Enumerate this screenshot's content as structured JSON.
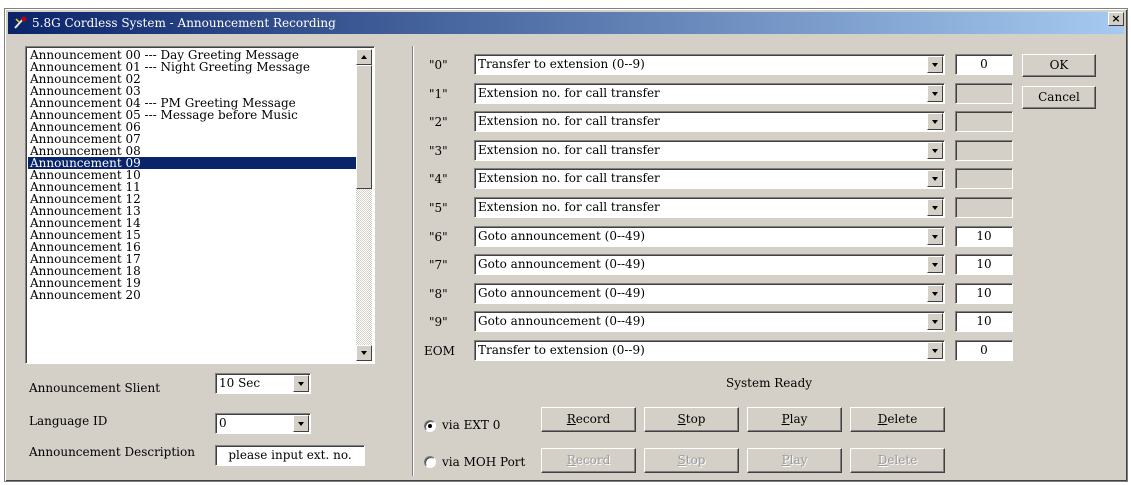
{
  "window": {
    "title": "5.8G Cordless System - Announcement Recording",
    "close_glyph": "×"
  },
  "announcements": {
    "items": [
      "Announcement 00 --- Day Greeting Message",
      "Announcement 01 --- Night Greeting Message",
      "Announcement 02",
      "Announcement 03",
      "Announcement 04 --- PM Greeting Message",
      "Announcement 05 --- Message before Music",
      "Announcement 06",
      "Announcement 07",
      "Announcement 08",
      "Announcement 09",
      "Announcement 10",
      "Announcement 11",
      "Announcement 12",
      "Announcement 13",
      "Announcement 14",
      "Announcement 15",
      "Announcement 16",
      "Announcement 17",
      "Announcement 18",
      "Announcement 19",
      "Announcement 20"
    ],
    "selected_index": 9
  },
  "settings": {
    "silent_label": "Announcement Slient",
    "silent_value": "10 Sec",
    "language_label": "Language ID",
    "language_value": "0",
    "description_label": "Announcement Description",
    "description_value": "please input ext. no."
  },
  "keys": [
    {
      "key": "\"0\"",
      "action": "Transfer to  extension (0--9)",
      "value": "0",
      "enabled": true
    },
    {
      "key": "\"1\"",
      "action": "Extension no. for call transfer",
      "value": "",
      "enabled": false
    },
    {
      "key": "\"2\"",
      "action": "Extension no. for call transfer",
      "value": "",
      "enabled": false
    },
    {
      "key": "\"3\"",
      "action": "Extension no. for call transfer",
      "value": "",
      "enabled": false
    },
    {
      "key": "\"4\"",
      "action": "Extension no. for call transfer",
      "value": "",
      "enabled": false
    },
    {
      "key": "\"5\"",
      "action": "Extension no. for call transfer",
      "value": "",
      "enabled": false
    },
    {
      "key": "\"6\"",
      "action": "Goto announcement (0--49)",
      "value": "10",
      "enabled": true
    },
    {
      "key": "\"7\"",
      "action": "Goto announcement (0--49)",
      "value": "10",
      "enabled": true
    },
    {
      "key": "\"8\"",
      "action": "Goto announcement (0--49)",
      "value": "10",
      "enabled": true
    },
    {
      "key": "\"9\"",
      "action": "Goto announcement (0--49)",
      "value": "10",
      "enabled": true
    },
    {
      "key": "EOM",
      "action": "Transfer to  extension (0--9)",
      "value": "0",
      "enabled": true
    }
  ],
  "dialog_buttons": {
    "ok": "OK",
    "cancel": "Cancel"
  },
  "status": "System Ready",
  "sources": [
    {
      "label": "via EXT 0",
      "checked": true,
      "enabled": true
    },
    {
      "label": "via MOH Port",
      "checked": false,
      "enabled": false
    }
  ],
  "actions": {
    "record": {
      "first": "R",
      "rest": "ecord"
    },
    "stop": {
      "first": "S",
      "rest": "top"
    },
    "play": {
      "first": "P",
      "rest": "lay"
    },
    "delete": {
      "first": "D",
      "rest": "elete"
    }
  }
}
